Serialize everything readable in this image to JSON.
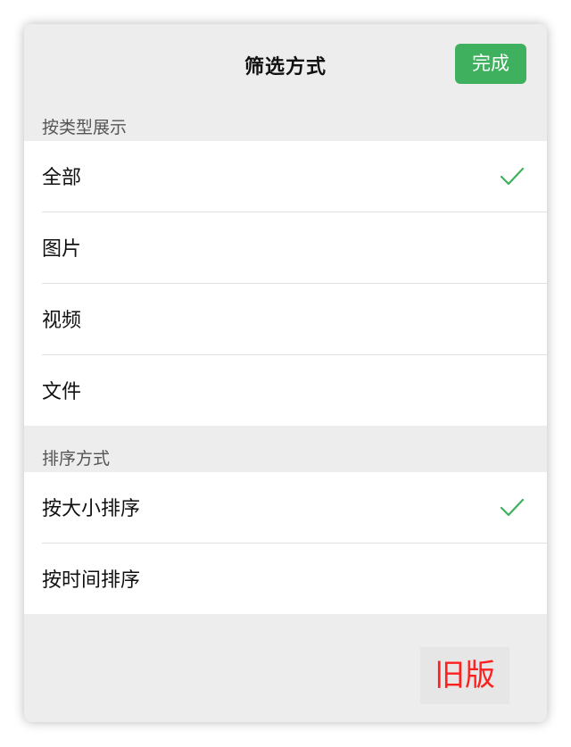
{
  "header": {
    "title": "筛选方式",
    "done_label": "完成"
  },
  "type_section": {
    "label": "按类型展示",
    "items": [
      {
        "label": "全部",
        "selected": true
      },
      {
        "label": "图片",
        "selected": false
      },
      {
        "label": "视频",
        "selected": false
      },
      {
        "label": "文件",
        "selected": false
      }
    ]
  },
  "sort_section": {
    "label": "排序方式",
    "items": [
      {
        "label": "按大小排序",
        "selected": true
      },
      {
        "label": "按时间排序",
        "selected": false
      }
    ]
  },
  "watermark": "旧版",
  "colors": {
    "accent": "#3fb05d",
    "watermark": "#ff1f1f",
    "background": "#ededed"
  }
}
